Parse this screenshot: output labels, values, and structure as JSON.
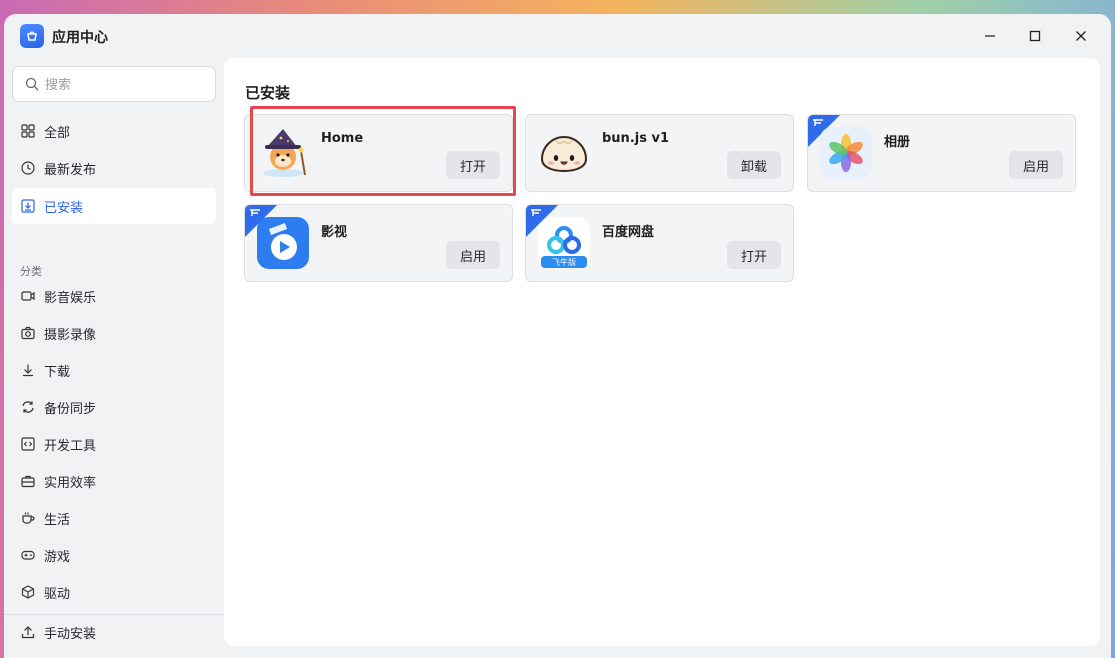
{
  "window": {
    "title": "应用中心"
  },
  "sidebar": {
    "search_placeholder": "搜索",
    "top_items": [
      {
        "label": "全部",
        "icon": "grid-icon"
      },
      {
        "label": "最新发布",
        "icon": "clock-icon"
      },
      {
        "label": "已安装",
        "icon": "download-box-icon",
        "active": true
      }
    ],
    "category_label": "分类",
    "categories": [
      {
        "label": "影音娱乐",
        "icon": "video-icon"
      },
      {
        "label": "摄影录像",
        "icon": "camera-icon"
      },
      {
        "label": "下载",
        "icon": "download-icon"
      },
      {
        "label": "备份同步",
        "icon": "sync-icon"
      },
      {
        "label": "开发工具",
        "icon": "code-icon"
      },
      {
        "label": "实用效率",
        "icon": "toolbox-icon"
      },
      {
        "label": "生活",
        "icon": "cup-icon"
      },
      {
        "label": "游戏",
        "icon": "gamepad-icon"
      },
      {
        "label": "驱动",
        "icon": "cube-icon"
      }
    ],
    "manual_install": "手动安装"
  },
  "main": {
    "title": "已安装",
    "apps": [
      {
        "name": "Home",
        "action": "打开",
        "icon": "shiba-wizard-icon",
        "badge": false,
        "highlighted": true
      },
      {
        "name": "bun.js v1",
        "action": "卸载",
        "icon": "bun-icon",
        "badge": false
      },
      {
        "name": "相册",
        "action": "启用",
        "icon": "photos-icon",
        "badge": true
      },
      {
        "name": "影视",
        "action": "启用",
        "icon": "video-player-icon",
        "badge": true
      },
      {
        "name": "百度网盘",
        "action": "打开",
        "icon": "baidu-netdisk-icon",
        "badge": true,
        "icon_caption": "飞牛版"
      }
    ]
  },
  "colors": {
    "accent": "#2a63e8",
    "highlight": "#e5484d",
    "badge": "#2f6bea"
  }
}
